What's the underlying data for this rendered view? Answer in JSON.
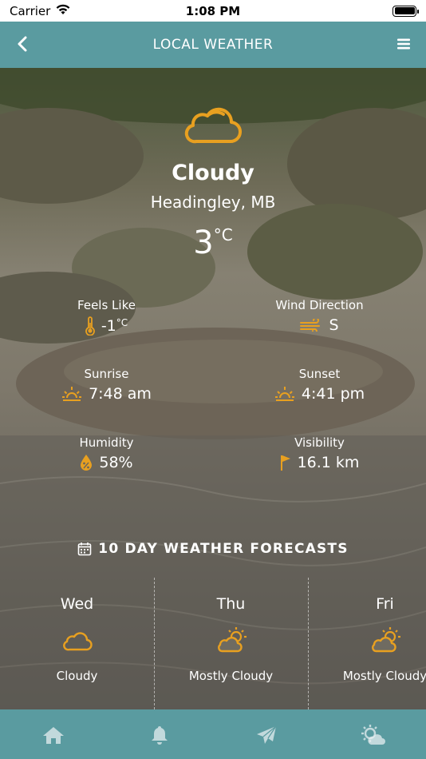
{
  "status_bar": {
    "carrier": "Carrier",
    "time": "1:08 PM"
  },
  "nav": {
    "title": "LOCAL WEATHER",
    "back_icon": "chevron-left-icon",
    "menu_icon": "hamburger-menu-icon"
  },
  "current": {
    "condition": "Cloudy",
    "condition_icon": "cloud-icon",
    "location": "Headingley, MB",
    "temperature": "3",
    "temperature_unit": "°C"
  },
  "stats": {
    "feels_like": {
      "label": "Feels Like",
      "value": "-1",
      "unit": "°C",
      "icon": "thermometer-icon"
    },
    "wind_direction": {
      "label": "Wind Direction",
      "value": "S",
      "icon": "wind-icon"
    },
    "sunrise": {
      "label": "Sunrise",
      "value": "7:48 am",
      "icon": "sunrise-icon"
    },
    "sunset": {
      "label": "Sunset",
      "value": "4:41 pm",
      "icon": "sunset-icon"
    },
    "humidity": {
      "label": "Humidity",
      "value": "58%",
      "icon": "humidity-drop-icon"
    },
    "visibility": {
      "label": "Visibility",
      "value": "16.1 km",
      "icon": "flag-icon"
    }
  },
  "forecast": {
    "heading": "10 DAY WEATHER FORECASTS",
    "heading_icon": "calendar-icon",
    "days": [
      {
        "day": "Wed",
        "description": "Cloudy",
        "icon": "cloud-icon"
      },
      {
        "day": "Thu",
        "description": "Mostly Cloudy",
        "icon": "partly-cloudy-icon"
      },
      {
        "day": "Fri",
        "description": "Mostly Cloudy",
        "icon": "partly-cloudy-icon"
      }
    ]
  },
  "tab_bar": {
    "items": [
      {
        "name": "home",
        "icon": "home-icon"
      },
      {
        "name": "notifications",
        "icon": "bell-icon"
      },
      {
        "name": "send",
        "icon": "paper-plane-icon"
      },
      {
        "name": "weather",
        "icon": "weather-icon"
      }
    ]
  },
  "colors": {
    "accent": "#e8a020",
    "nav": "#5a9ba0",
    "text": "#ffffff"
  }
}
